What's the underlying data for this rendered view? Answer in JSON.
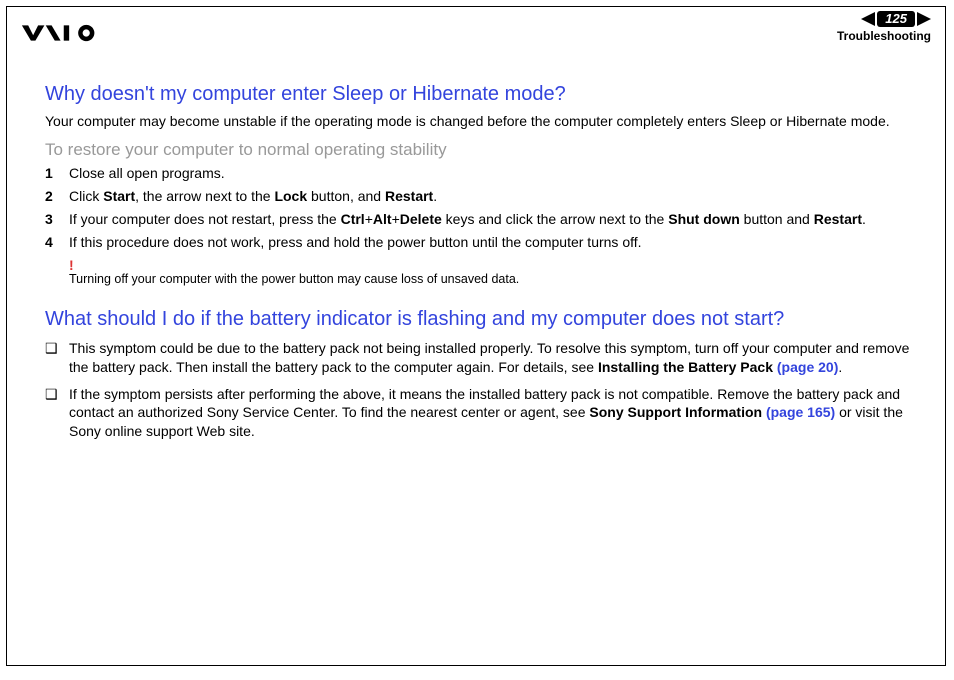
{
  "header": {
    "page_number": "125",
    "section": "Troubleshooting"
  },
  "q1": {
    "title": "Why doesn't my computer enter Sleep or Hibernate mode?",
    "intro": "Your computer may become unstable if the operating mode is changed before the computer completely enters Sleep or Hibernate mode.",
    "subhead": "To restore your computer to normal operating stability",
    "steps": {
      "s1": "Close all open programs.",
      "s2_a": "Click ",
      "s2_b": "Start",
      "s2_c": ", the arrow next to the ",
      "s2_d": "Lock",
      "s2_e": " button, and ",
      "s2_f": "Restart",
      "s2_g": ".",
      "s3_a": "If your computer does not restart, press the ",
      "s3_b": "Ctrl",
      "s3_c": "+",
      "s3_d": "Alt",
      "s3_e": "+",
      "s3_f": "Delete",
      "s3_g": " keys and click the arrow next to the ",
      "s3_h": "Shut down",
      "s3_i": " button and ",
      "s3_j": "Restart",
      "s3_k": ".",
      "s4": "If this procedure does not work, press and hold the power button until the computer turns off."
    },
    "warning": "Turning off your computer with the power button may cause loss of unsaved data."
  },
  "q2": {
    "title": "What should I do if the battery indicator is flashing and my computer does not start?",
    "b1_a": "This symptom could be due to the battery pack not being installed properly. To resolve this symptom, turn off your computer and remove the battery pack. Then install the battery pack to the computer again. For details, see ",
    "b1_b": "Installing the Battery Pack ",
    "b1_link": "(page 20)",
    "b1_c": ".",
    "b2_a": "If the symptom persists after performing the above, it means the installed battery pack is not compatible. Remove the battery pack and contact an authorized Sony Service Center. To find the nearest center or agent, see ",
    "b2_b": "Sony Support Information ",
    "b2_link": "(page 165)",
    "b2_c": " or visit the Sony online support Web site."
  }
}
